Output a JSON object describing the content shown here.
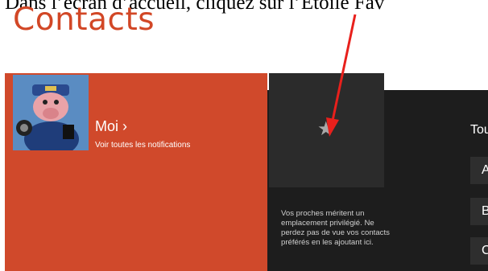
{
  "caption": "Dans l’écran d’accueil, cliquez sur l’Étoile Fav",
  "app": {
    "title": "Contacts"
  },
  "me": {
    "label": "Moi ›",
    "link": "Voir toutes les notifications"
  },
  "favorites": {
    "star_icon": "star-icon",
    "description": "Vos proches méritent un emplacement privilégié. Ne perdez pas de vue vos contacts préférés en les ajoutant ici."
  },
  "all_contacts": {
    "label": "Tou",
    "letters": [
      "A",
      "B",
      "C"
    ]
  },
  "colors": {
    "accent": "#d24726",
    "tile": "#d0492b",
    "dark_bg": "#1d1d1d",
    "arrow": "#e8201c"
  }
}
